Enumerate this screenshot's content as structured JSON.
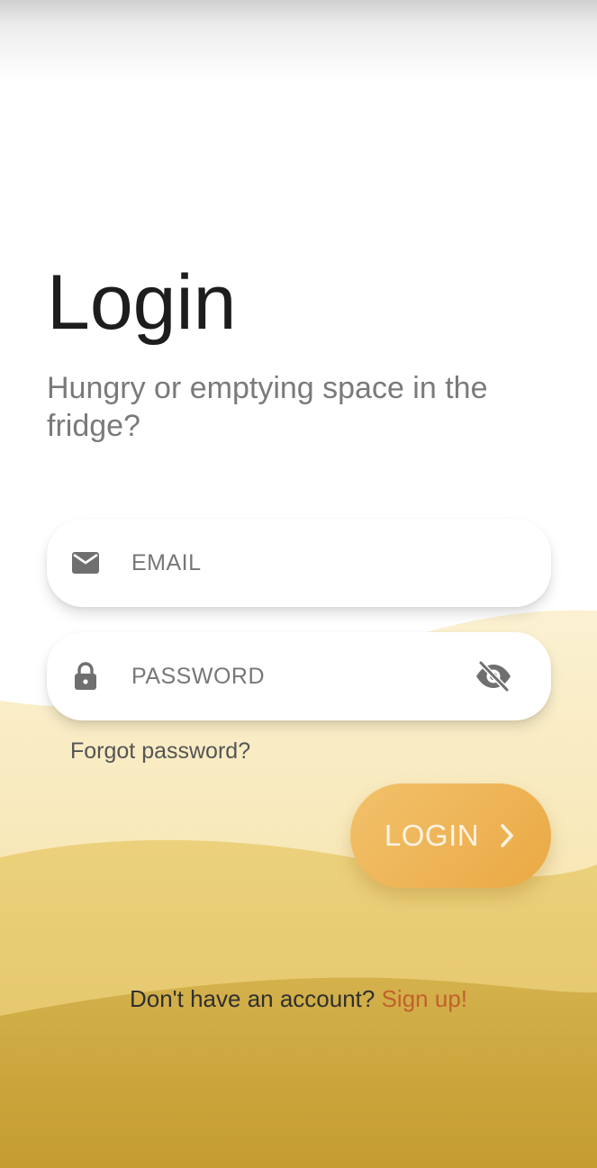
{
  "login": {
    "title": "Login",
    "subtitle": "Hungry or emptying space in the fridge?",
    "email_placeholder": "EMAIL",
    "password_placeholder": "PASSWORD",
    "forgot_label": "Forgot password?",
    "submit_label": "LOGIN",
    "signup_prompt": "Don't have an account?",
    "signup_link": "Sign up!"
  },
  "icons": {
    "email": "mail-icon",
    "password": "lock-icon",
    "visibility": "eye-off-icon",
    "submit": "chevron-right-icon"
  },
  "colors": {
    "title": "#1d1d1d",
    "subtitle": "#7a7a7a",
    "button": "#eeb057",
    "link": "#c0612d",
    "wave_light": "#f5e3a6",
    "wave_mid": "#e8c96b",
    "wave_dark": "#c9a33a"
  }
}
